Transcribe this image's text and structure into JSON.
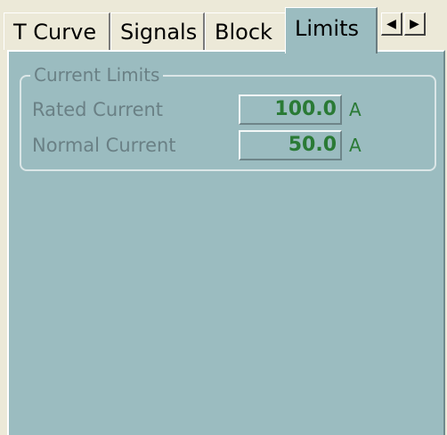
{
  "tabs": [
    {
      "label": "T Curve",
      "active": false
    },
    {
      "label": "Signals",
      "active": false
    },
    {
      "label": "Block",
      "active": false
    },
    {
      "label": "Limits",
      "active": true
    }
  ],
  "tab_scroll": {
    "left_glyph": "◀",
    "right_glyph": "▶"
  },
  "group": {
    "title": "Current Limits",
    "fields": [
      {
        "label": "Rated Current",
        "value": "100.0",
        "unit": "A"
      },
      {
        "label": "Normal Current",
        "value": "50.0",
        "unit": "A"
      }
    ]
  },
  "colors": {
    "panel_bg": "#9bbcc0",
    "label_text": "#6a8085",
    "value_text": "#2a7a35"
  }
}
